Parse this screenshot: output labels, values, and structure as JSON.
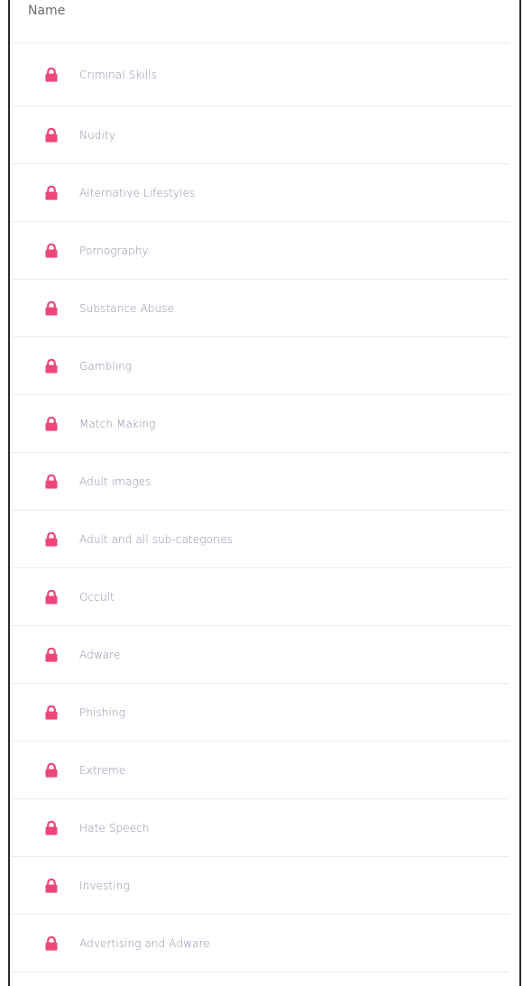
{
  "table": {
    "header": {
      "name_label": "Name"
    },
    "rows": [
      {
        "label": "Criminal Skills",
        "icon": "lock-icon"
      },
      {
        "label": "Nudity",
        "icon": "lock-icon"
      },
      {
        "label": "Alternative Lifestyles",
        "icon": "lock-icon"
      },
      {
        "label": "Pornography",
        "icon": "lock-icon"
      },
      {
        "label": "Substance Abuse",
        "icon": "lock-icon"
      },
      {
        "label": "Gambling",
        "icon": "lock-icon"
      },
      {
        "label": "Match Making",
        "icon": "lock-icon"
      },
      {
        "label": "Adult images",
        "icon": "lock-icon"
      },
      {
        "label": "Adult and all sub-categories",
        "icon": "lock-icon"
      },
      {
        "label": "Occult",
        "icon": "lock-icon"
      },
      {
        "label": "Adware",
        "icon": "lock-icon"
      },
      {
        "label": "Phishing",
        "icon": "lock-icon"
      },
      {
        "label": "Extreme",
        "icon": "lock-icon"
      },
      {
        "label": "Hate Speech",
        "icon": "lock-icon"
      },
      {
        "label": "Investing",
        "icon": "lock-icon"
      },
      {
        "label": "Advertising and Adware",
        "icon": "lock-icon"
      }
    ]
  },
  "colors": {
    "lock": "#f0457a",
    "label": "#8e8ba8",
    "divider": "#ececec",
    "frame": "#2a2a2a"
  }
}
